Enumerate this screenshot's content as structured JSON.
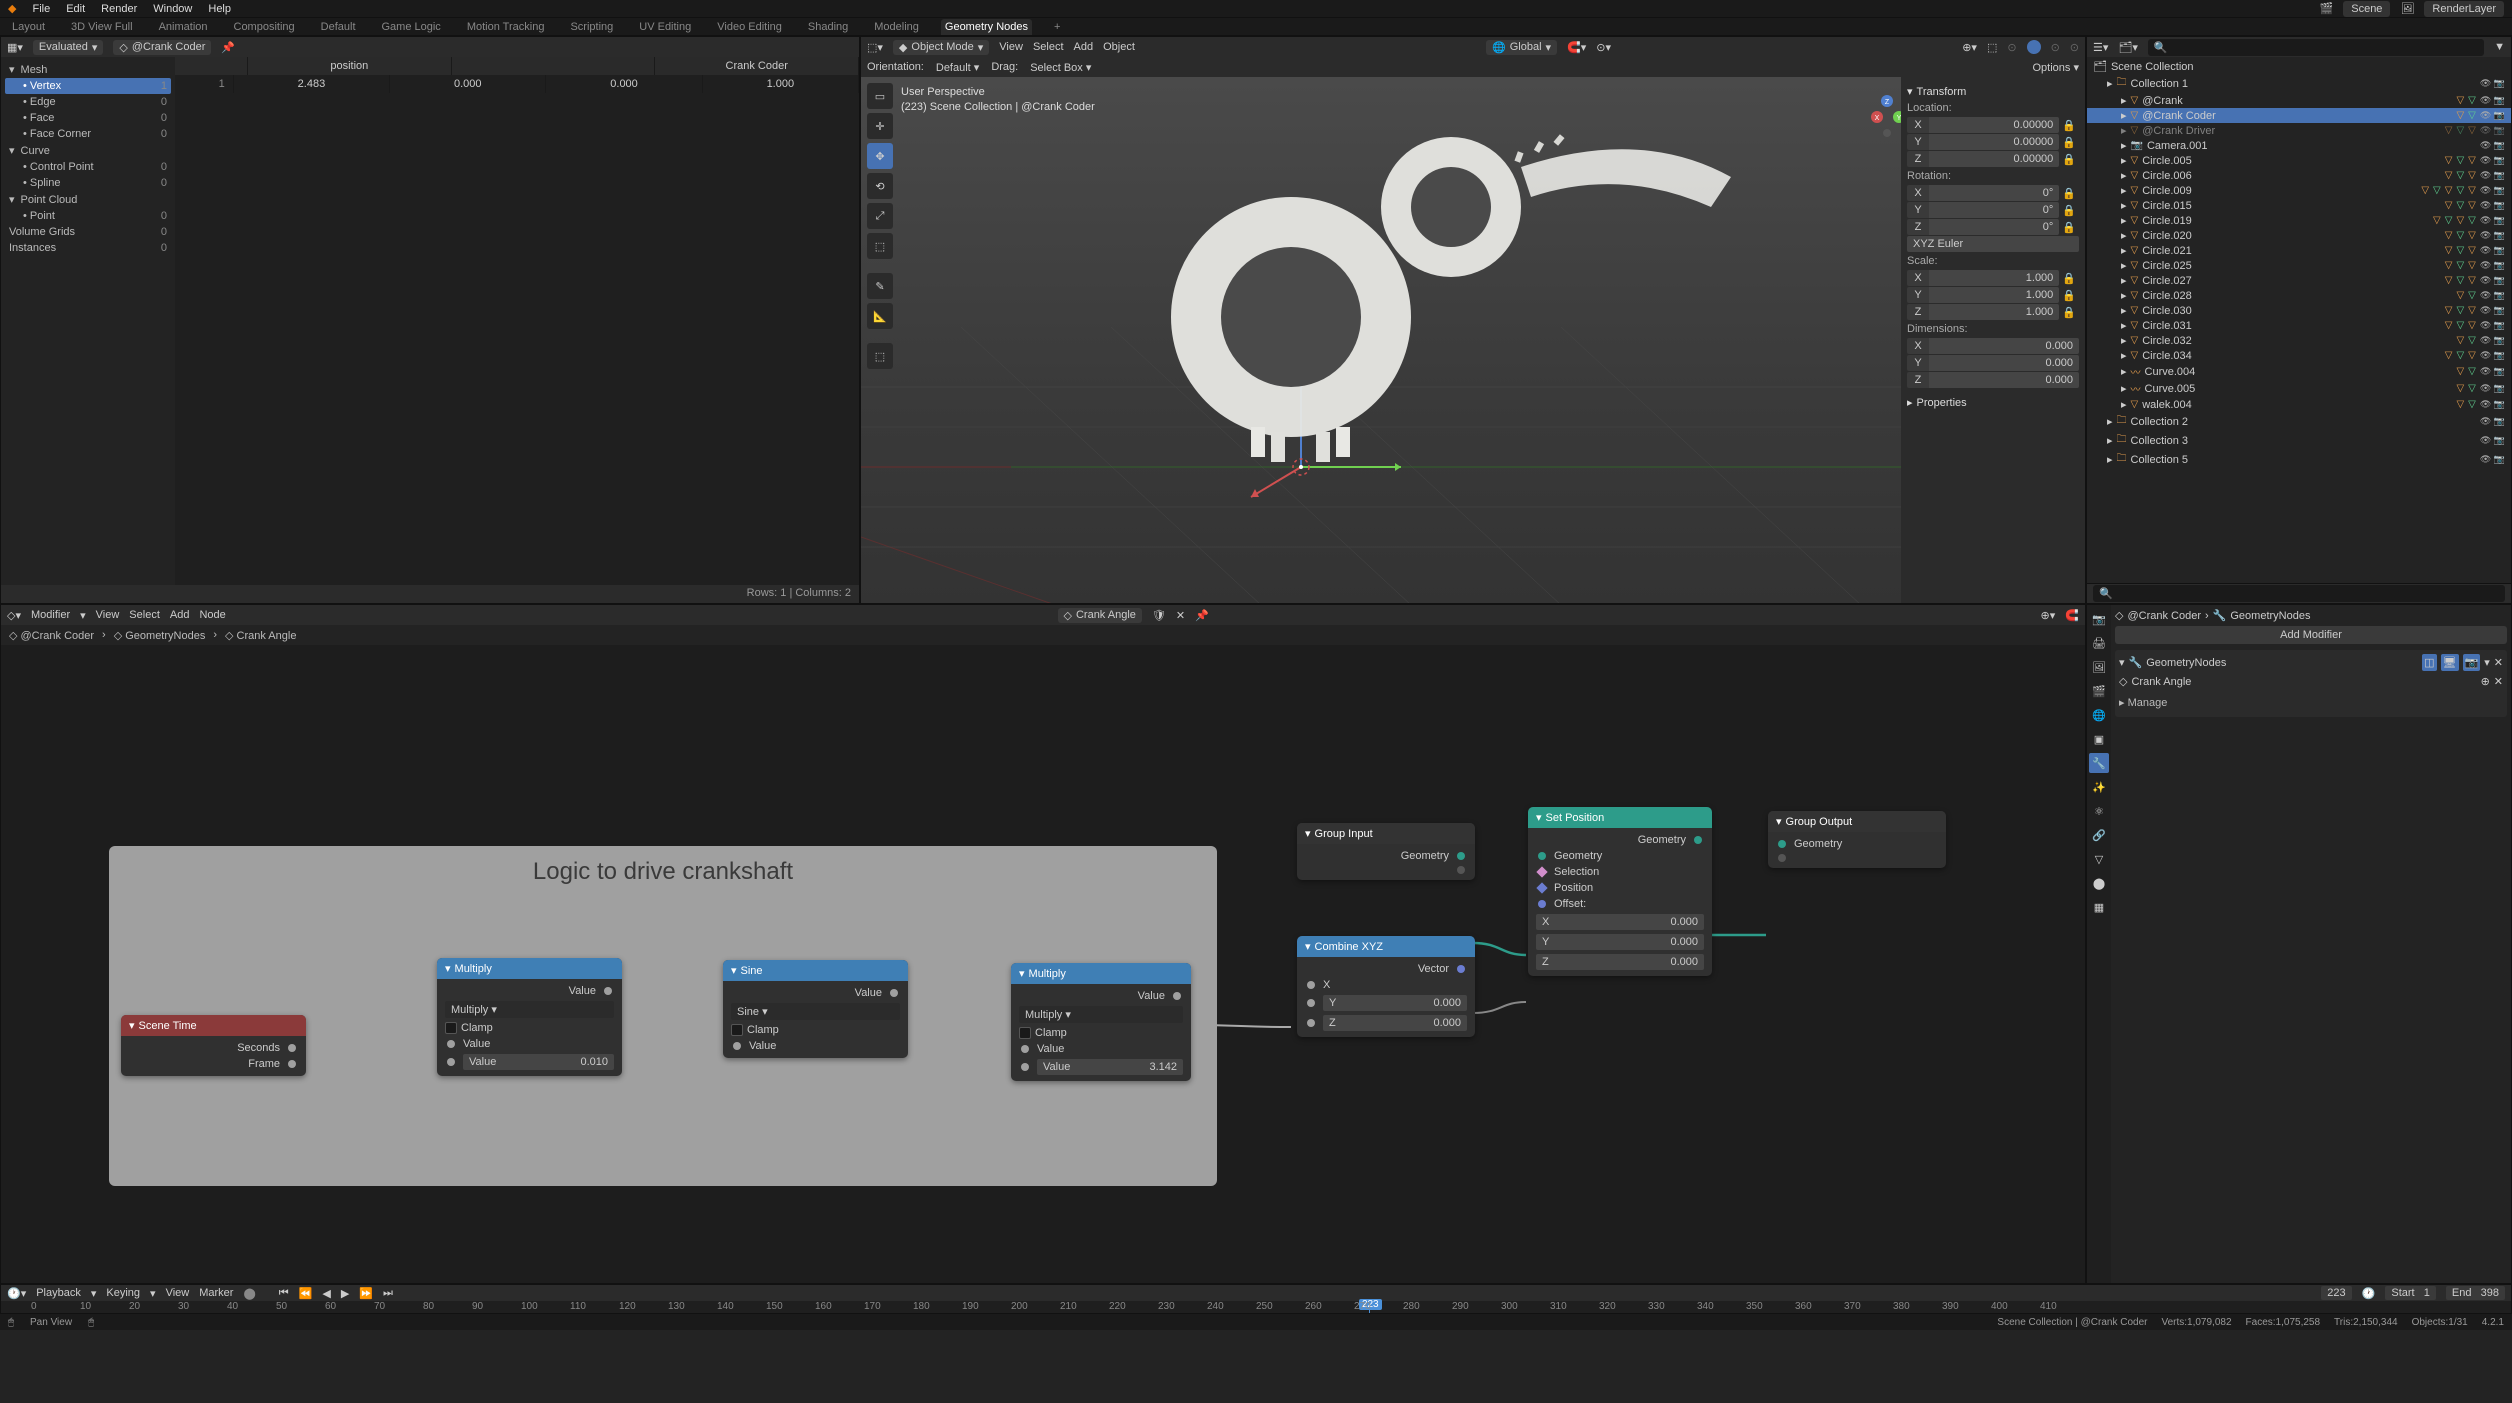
{
  "topbar": {
    "menus": [
      "File",
      "Edit",
      "Render",
      "Window",
      "Help"
    ],
    "scene_label": "Scene",
    "layer_label": "RenderLayer"
  },
  "workspaces": {
    "tabs": [
      "Layout",
      "3D View Full",
      "Animation",
      "Compositing",
      "Default",
      "Game Logic",
      "Motion Tracking",
      "Scripting",
      "UV Editing",
      "Video Editing",
      "Shading",
      "Modeling",
      "Geometry Nodes"
    ],
    "active": 12
  },
  "spreadsheet": {
    "mode": "Evaluated",
    "object": "@Crank Coder",
    "tree": [
      {
        "label": "Mesh",
        "indent": 0,
        "expand": true
      },
      {
        "label": "Vertex",
        "indent": 1,
        "sel": true,
        "count": 1
      },
      {
        "label": "Edge",
        "indent": 1,
        "count": 0
      },
      {
        "label": "Face",
        "indent": 1,
        "count": 0
      },
      {
        "label": "Face Corner",
        "indent": 1,
        "count": 0
      },
      {
        "label": "Curve",
        "indent": 0,
        "expand": true
      },
      {
        "label": "Control Point",
        "indent": 1,
        "count": 0
      },
      {
        "label": "Spline",
        "indent": 1,
        "count": 0
      },
      {
        "label": "Point Cloud",
        "indent": 0,
        "expand": true
      },
      {
        "label": "Point",
        "indent": 1,
        "count": 0
      },
      {
        "label": "Volume Grids",
        "indent": 0,
        "count": 0
      },
      {
        "label": "Instances",
        "indent": 0,
        "count": 0
      }
    ],
    "columns": [
      "",
      "position",
      "",
      "Crank Coder"
    ],
    "row": [
      "1",
      "2.483",
      "0.000",
      "0.000",
      "1.000"
    ],
    "footer": "Rows: 1   |   Columns: 2"
  },
  "view3d": {
    "mode": "Object Mode",
    "header_menus": [
      "View",
      "Select",
      "Add",
      "Object"
    ],
    "orientation_label": "Orientation:",
    "orientation": "Default",
    "drag_label": "Drag:",
    "drag": "Select Box",
    "pivot": "Global",
    "options": "Options",
    "overlay": {
      "line1": "User Perspective",
      "line2": "(223) Scene Collection | @Crank Coder"
    },
    "transform": {
      "title": "Transform",
      "location_label": "Location:",
      "location": {
        "x": "0.00000",
        "y": "0.00000",
        "z": "0.00000"
      },
      "rotation_label": "Rotation:",
      "rotation": {
        "x": "0°",
        "y": "0°",
        "z": "0°"
      },
      "rotation_mode": "XYZ Euler",
      "scale_label": "Scale:",
      "scale": {
        "x": "1.000",
        "y": "1.000",
        "z": "1.000"
      },
      "dimensions_label": "Dimensions:",
      "dimensions": {
        "x": "0.000",
        "y": "0.000",
        "z": "0.000"
      },
      "properties": "Properties"
    }
  },
  "outliner": {
    "root": "Scene Collection",
    "search_placeholder": "Search",
    "items": [
      {
        "name": "Collection 1",
        "type": "collection",
        "indent": 1
      },
      {
        "name": "@Crank",
        "type": "mesh",
        "indent": 2,
        "tris": 2
      },
      {
        "name": "@Crank Coder",
        "type": "mesh",
        "indent": 2,
        "sel": true,
        "tris": 2,
        "extra": true
      },
      {
        "name": "@Crank Driver",
        "type": "mesh",
        "indent": 2,
        "dim": true,
        "tris": 3
      },
      {
        "name": "Camera.001",
        "type": "camera",
        "indent": 2
      },
      {
        "name": "Circle.005",
        "type": "mesh",
        "indent": 2,
        "tris": 3
      },
      {
        "name": "Circle.006",
        "type": "mesh",
        "indent": 2,
        "tris": 3
      },
      {
        "name": "Circle.009",
        "type": "mesh",
        "indent": 2,
        "tris": 5
      },
      {
        "name": "Circle.015",
        "type": "mesh",
        "indent": 2,
        "tris": 3
      },
      {
        "name": "Circle.019",
        "type": "mesh",
        "indent": 2,
        "tris": 4
      },
      {
        "name": "Circle.020",
        "type": "mesh",
        "indent": 2,
        "tris": 3
      },
      {
        "name": "Circle.021",
        "type": "mesh",
        "indent": 2,
        "tris": 3
      },
      {
        "name": "Circle.025",
        "type": "mesh",
        "indent": 2,
        "tris": 3
      },
      {
        "name": "Circle.027",
        "type": "mesh",
        "indent": 2,
        "tris": 3
      },
      {
        "name": "Circle.028",
        "type": "mesh",
        "indent": 2,
        "tris": 2
      },
      {
        "name": "Circle.030",
        "type": "mesh",
        "indent": 2,
        "tris": 3
      },
      {
        "name": "Circle.031",
        "type": "mesh",
        "indent": 2,
        "tris": 3
      },
      {
        "name": "Circle.032",
        "type": "mesh",
        "indent": 2,
        "tris": 2
      },
      {
        "name": "Circle.034",
        "type": "mesh",
        "indent": 2,
        "tris": 3
      },
      {
        "name": "Curve.004",
        "type": "curve",
        "indent": 2,
        "tris": 2
      },
      {
        "name": "Curve.005",
        "type": "curve",
        "indent": 2,
        "tris": 2
      },
      {
        "name": "walek.004",
        "type": "mesh",
        "indent": 2,
        "tris": 2
      },
      {
        "name": "Collection 2",
        "type": "collection",
        "indent": 1
      },
      {
        "name": "Collection 3",
        "type": "collection",
        "indent": 1
      },
      {
        "name": "Collection 5",
        "type": "collection",
        "indent": 1
      }
    ]
  },
  "nodeeditor": {
    "header_menus": [
      "Modifier",
      "View",
      "Select",
      "Add",
      "Node"
    ],
    "datablock": "Crank Angle",
    "breadcrumb": [
      "@Crank Coder",
      "GeometryNodes",
      "Crank Angle"
    ],
    "frame_label": "Logic to drive crankshaft",
    "nodes": {
      "scene_time": {
        "title": "Scene Time",
        "outputs": [
          "Seconds",
          "Frame"
        ]
      },
      "mul1": {
        "title": "Multiply",
        "op": "Multiply",
        "clamp": "Clamp",
        "value_label": "Value",
        "value": "0.010"
      },
      "sine": {
        "title": "Sine",
        "op": "Sine",
        "clamp": "Clamp",
        "value_label": "Value"
      },
      "mul2": {
        "title": "Multiply",
        "op": "Multiply",
        "clamp": "Clamp",
        "value_label": "Value",
        "value": "3.142"
      },
      "combine": {
        "title": "Combine XYZ",
        "out": "Vector",
        "x": "X",
        "y": "Y",
        "z": "Z",
        "yval": "0.000",
        "zval": "0.000"
      },
      "group_input": {
        "title": "Group Input",
        "out": "Geometry"
      },
      "set_pos": {
        "title": "Set Position",
        "out": "Geometry",
        "in_geo": "Geometry",
        "in_sel": "Selection",
        "in_pos": "Position",
        "in_off": "Offset:",
        "x": "X",
        "y": "Y",
        "z": "Z",
        "xval": "0.000",
        "yval": "0.000",
        "zval": "0.000"
      },
      "group_output": {
        "title": "Group Output",
        "in": "Geometry"
      }
    }
  },
  "properties": {
    "breadcrumb": [
      "@Crank Coder",
      "GeometryNodes"
    ],
    "add_modifier": "Add Modifier",
    "modifier_name": "GeometryNodes",
    "node_group": "Crank Angle",
    "manage": "Manage"
  },
  "timeline": {
    "menus": [
      "Playback",
      "Keying",
      "View",
      "Marker"
    ],
    "current": "223",
    "start_label": "Start",
    "start": "1",
    "end_label": "End",
    "end": "398",
    "ticks": [
      "0",
      "10",
      "20",
      "30",
      "40",
      "50",
      "60",
      "70",
      "80",
      "90",
      "100",
      "110",
      "120",
      "130",
      "140",
      "150",
      "160",
      "170",
      "180",
      "190",
      "200",
      "210",
      "220",
      "230",
      "240",
      "250",
      "260",
      "270",
      "280",
      "290",
      "300",
      "310",
      "320",
      "330",
      "340",
      "350",
      "360",
      "370",
      "380",
      "390",
      "400",
      "410"
    ]
  },
  "statusbar": {
    "hint1": "Pan View",
    "right": [
      "Scene Collection | @Crank Coder",
      "Verts:1,079,082",
      "Faces:1,075,258",
      "Tris:2,150,344",
      "Objects:1/31",
      "4.2.1"
    ]
  }
}
